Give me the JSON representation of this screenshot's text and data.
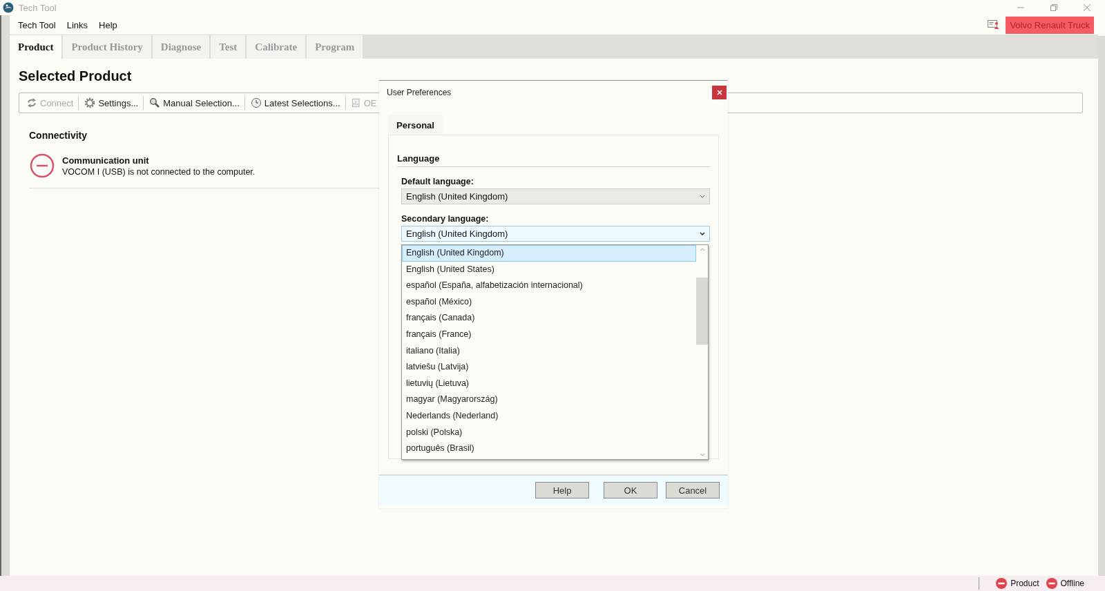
{
  "window": {
    "title": "Tech Tool"
  },
  "menu": [
    "Tech Tool",
    "Links",
    "Help"
  ],
  "badge": "Volvo Renault Truck",
  "tabs": [
    {
      "label": "Product",
      "selected": true
    },
    {
      "label": "Product History",
      "selected": false
    },
    {
      "label": "Diagnose",
      "selected": false
    },
    {
      "label": "Test",
      "selected": false
    },
    {
      "label": "Calibrate",
      "selected": false
    },
    {
      "label": "Program",
      "selected": false
    }
  ],
  "page_title": "Selected Product",
  "toolbar": [
    {
      "label": "Connect",
      "disabled": true
    },
    {
      "label": "Settings...",
      "disabled": false
    },
    {
      "label": "Manual Selection...",
      "disabled": false
    },
    {
      "label": "Latest Selections...",
      "disabled": false
    },
    {
      "label": "OE",
      "disabled": true
    }
  ],
  "connectivity": {
    "heading": "Connectivity",
    "items": [
      {
        "title": "Communication unit",
        "message": "VOCOM I (USB) is not connected to the computer."
      }
    ]
  },
  "dialog": {
    "title": "User Preferences",
    "tabs": [
      {
        "label": "Personal",
        "selected": true
      }
    ],
    "section": "Language",
    "default_language": {
      "label": "Default language:",
      "value": "English (United Kingdom)"
    },
    "secondary_language": {
      "label": "Secondary language:",
      "value": "English (United Kingdom)",
      "expanded": true,
      "options": [
        {
          "label": "English (United Kingdom)",
          "selected": true
        },
        {
          "label": "English (United States)",
          "selected": false
        },
        {
          "label": "español (España, alfabetización internacional)",
          "selected": false
        },
        {
          "label": "español (México)",
          "selected": false
        },
        {
          "label": "français (Canada)",
          "selected": false
        },
        {
          "label": "français (France)",
          "selected": false
        },
        {
          "label": "italiano (Italia)",
          "selected": false
        },
        {
          "label": "latviešu (Latvija)",
          "selected": false
        },
        {
          "label": "lietuvių (Lietuva)",
          "selected": false
        },
        {
          "label": "magyar (Magyarország)",
          "selected": false
        },
        {
          "label": "Nederlands (Nederland)",
          "selected": false
        },
        {
          "label": "polski (Polska)",
          "selected": false
        },
        {
          "label": "português (Brasil)",
          "selected": false
        }
      ]
    },
    "buttons": [
      "Help",
      "OK",
      "Cancel"
    ]
  },
  "status_bar": [
    "Product",
    "Offline"
  ]
}
